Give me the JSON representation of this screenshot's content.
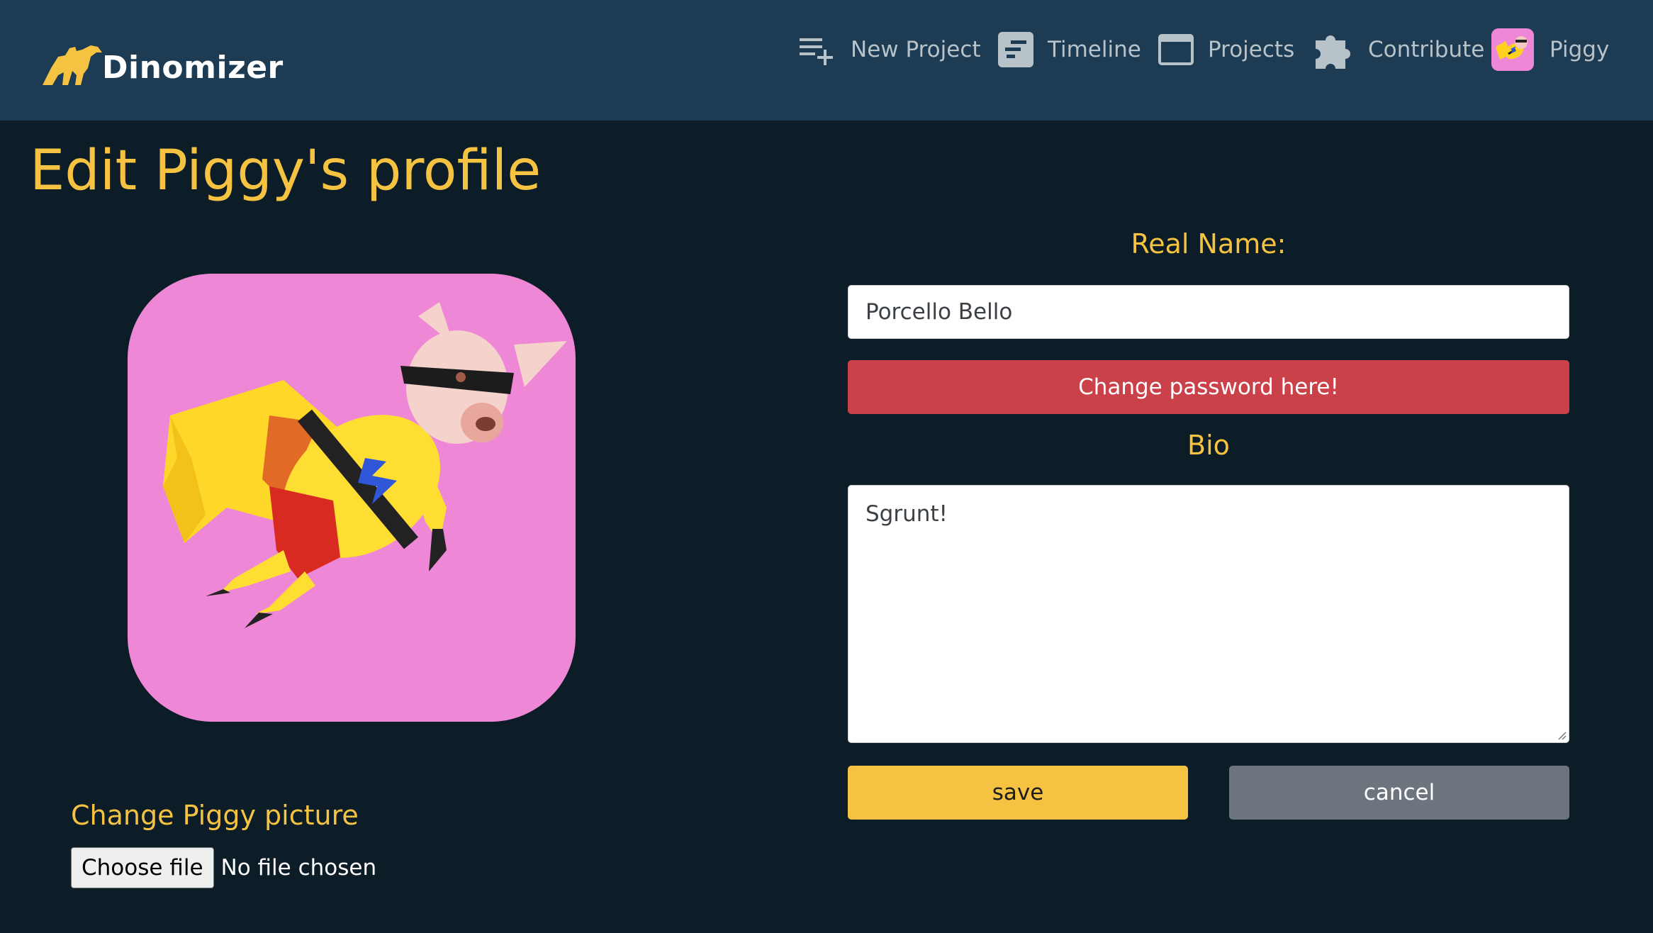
{
  "navbar": {
    "brand": "Dinomizer",
    "items": [
      {
        "label": "New Project",
        "icon": "playlist-add-icon"
      },
      {
        "label": "Timeline",
        "icon": "timeline-icon"
      },
      {
        "label": "Projects",
        "icon": "window-icon"
      },
      {
        "label": "Contribute",
        "icon": "puzzle-icon"
      }
    ],
    "user": {
      "name": "Piggy"
    }
  },
  "page": {
    "title": "Edit Piggy's profile",
    "change_picture_label": "Change Piggy picture",
    "file_button_label": "Choose file",
    "file_status": "No file chosen"
  },
  "form": {
    "real_name_label": "Real Name:",
    "real_name_value": "Porcello Bello",
    "change_password_label": "Change password here!",
    "bio_label": "Bio",
    "bio_value": "Sgrunt!",
    "save_label": "save",
    "cancel_label": "cancel"
  },
  "colors": {
    "navbar_bg": "#1d3b52",
    "page_bg": "#0c1d27",
    "accent": "#f5c242",
    "danger": "#cb414a",
    "secondary": "#6c757d",
    "avatar_bg": "#ee88d6"
  }
}
